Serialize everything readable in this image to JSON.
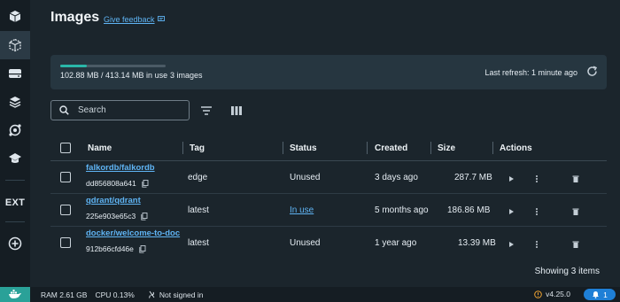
{
  "header": {
    "title": "Images",
    "feedback_label": "Give feedback"
  },
  "usage": {
    "used_fraction": 0.249,
    "text": "102.88 MB / 413.14 MB in use",
    "count_text": "3 images",
    "refresh_text": "Last refresh: 1 minute ago"
  },
  "search": {
    "placeholder": "Search"
  },
  "table": {
    "columns": [
      "Name",
      "Tag",
      "Status",
      "Created",
      "Size",
      "Actions"
    ],
    "rows": [
      {
        "name": "falkordb/falkordb",
        "id": "dd856808a641",
        "tag": "edge",
        "status": "Unused",
        "created": "3 days ago",
        "size": "287.7 MB"
      },
      {
        "name": "qdrant/qdrant",
        "id": "225e903e65c3",
        "tag": "latest",
        "status": "In use",
        "created": "5 months ago",
        "size": "186.86 MB"
      },
      {
        "name": "docker/welcome-to-doc",
        "id": "912b66cfd46e",
        "tag": "latest",
        "status": "Unused",
        "created": "1 year ago",
        "size": "13.39 MB"
      }
    ],
    "footer": "Showing 3 items"
  },
  "sidebar": {
    "ext_label": "EXT",
    "items": [
      "containers-icon",
      "images-icon",
      "volumes-icon",
      "builds-icon",
      "scout-icon",
      "learning-icon"
    ]
  },
  "statusbar": {
    "ram": "RAM 2.61 GB",
    "cpu": "CPU 0.13%",
    "signin": "Not signed in",
    "version": "v4.25.0",
    "notifications": "1"
  },
  "colors": {
    "accent": "#5fb4f4",
    "usage_bar": "#2ab7a9",
    "background": "#1b252c",
    "notif": "#1e7fd6",
    "whale": "#2aa198"
  }
}
